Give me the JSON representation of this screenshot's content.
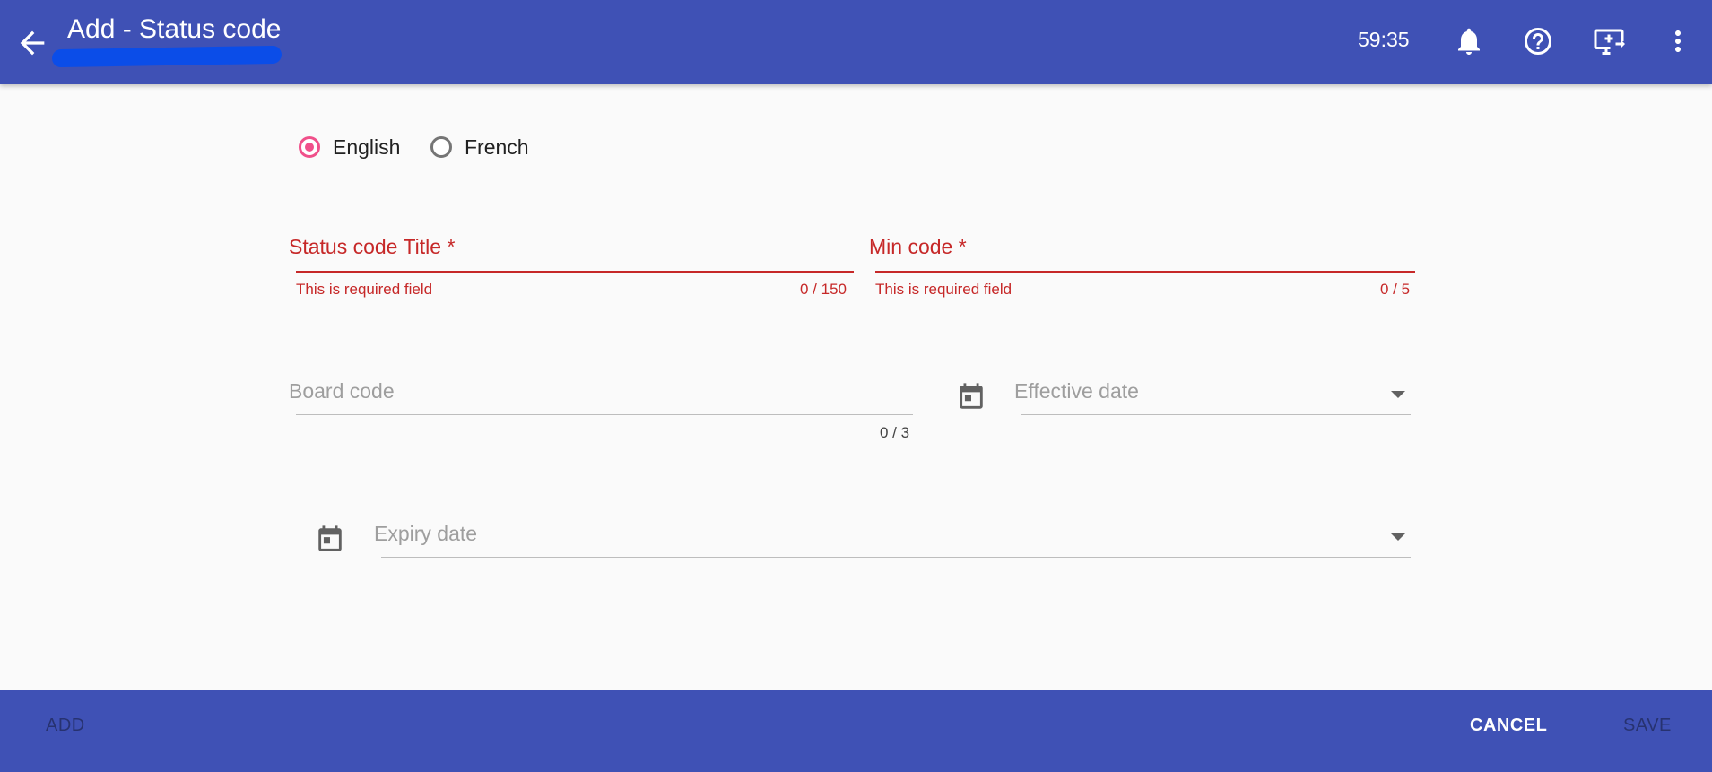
{
  "header": {
    "title": "Add - Status code",
    "timer": "59:35",
    "icons": [
      "arrow-back-icon",
      "bell-icon",
      "help-circle-icon",
      "screen-share-icon",
      "more-vert-icon"
    ]
  },
  "language": {
    "options": [
      {
        "label": "English",
        "checked": true
      },
      {
        "label": "French",
        "checked": false
      }
    ]
  },
  "form": {
    "status_title": {
      "label": "Status code Title",
      "required": "*",
      "error": "This is required field",
      "counter": "0 / 150"
    },
    "min_code": {
      "label": "Min code",
      "required": "*",
      "error": "This is required field",
      "counter": "0 / 5"
    },
    "board_code": {
      "placeholder": "Board code",
      "counter": "0 / 3"
    },
    "effective_date": {
      "placeholder": "Effective date"
    },
    "expiry_date": {
      "placeholder": "Expiry date"
    }
  },
  "footer": {
    "add_label": "ADD",
    "cancel_label": "CANCEL",
    "save_label": "SAVE"
  },
  "colors": {
    "primary": "#3f51b5",
    "accent": "#f0508a",
    "error": "#c62828",
    "background": "#fafafa"
  }
}
